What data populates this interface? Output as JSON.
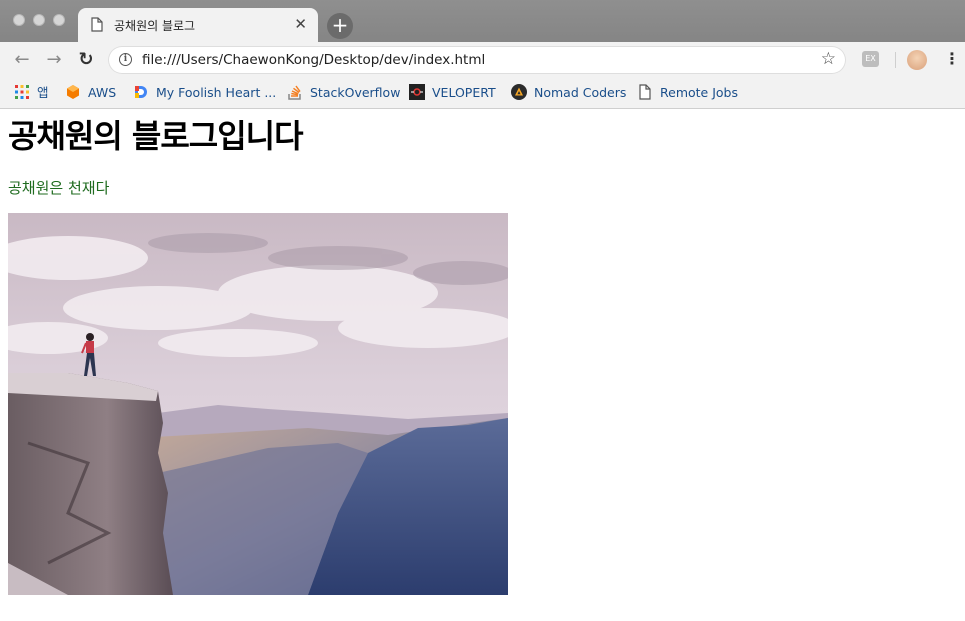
{
  "tab": {
    "title": "공채원의 블로그",
    "close_glyph": "✕"
  },
  "new_tab_glyph": "+",
  "toolbar": {
    "back_glyph": "←",
    "forward_glyph": "→",
    "reload_glyph": "↻",
    "url": "file:///Users/ChaewonKong/Desktop/dev/index.html",
    "star_glyph": "☆",
    "extension_label": "EX",
    "menu_glyph": "⋮"
  },
  "bookmarks": [
    {
      "label": "앱",
      "icon": "apps-grid-icon"
    },
    {
      "label": "AWS",
      "icon": "aws-icon"
    },
    {
      "label": "My Foolish Heart ...",
      "icon": "d-logo-icon"
    },
    {
      "label": "StackOverflow",
      "icon": "stackoverflow-icon"
    },
    {
      "label": "VELOPERT",
      "icon": "velopert-icon"
    },
    {
      "label": "Nomad Coders",
      "icon": "nomad-icon"
    },
    {
      "label": "Remote Jobs",
      "icon": "document-icon"
    }
  ],
  "page": {
    "heading": "공채원의 블로그입니다",
    "paragraph": "공채원은 천재다",
    "paragraph_color": "#1f6b1f"
  },
  "colors": {
    "link": "#1a4e8a",
    "chrome_bg": "#f2f2f2",
    "tabstrip_bg": "#8a8a8a"
  }
}
